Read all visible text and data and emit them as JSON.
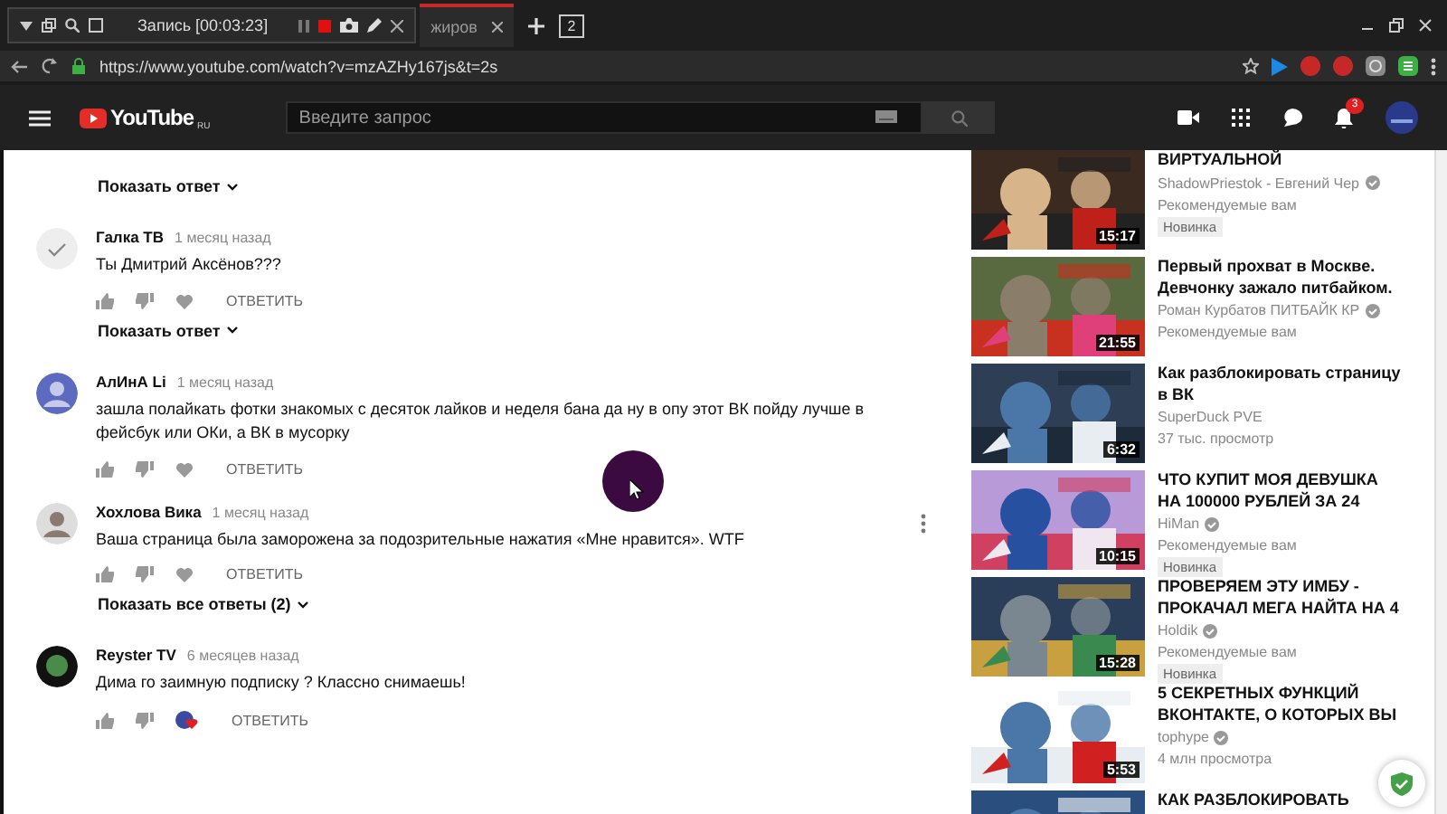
{
  "recorder": {
    "status": "Запись [00:03:23]"
  },
  "browser": {
    "tab_title": "жиров",
    "tab_count": "2",
    "url": "https://www.youtube.com/watch?v=mzAZHy167js&t=2s"
  },
  "youtube": {
    "logo": "YouTube",
    "region": "RU",
    "search": {
      "placeholder": "Введите запрос"
    },
    "notifications": "3"
  },
  "comments": [
    {
      "kind": "show_replies",
      "label": "Показать ответ"
    },
    {
      "kind": "comment",
      "author": "Галка ТВ",
      "time": "1 месяц назад",
      "text": "Ты Дмитрий Аксёнов???",
      "avatar": {
        "kind": "check"
      },
      "creator_heart": false,
      "menu": false,
      "reply": "ОТВЕТИТЬ"
    },
    {
      "kind": "show_replies",
      "label": "Показать ответ"
    },
    {
      "kind": "comment",
      "author": "АлИнА Li",
      "time": "1 месяц назад",
      "text": "зашла полайкать фотки знакомых с десяток лайков и неделя бана да ну в опу этот ВК пойду лучше в фейсбук или ОКи, а ВК в мусорку",
      "avatar": {
        "kind": "person"
      },
      "creator_heart": false,
      "menu": false,
      "reply": "ОТВЕТИТЬ"
    },
    {
      "kind": "comment",
      "author": "Хохлова Вика",
      "time": "1 месяц назад",
      "text": "Ваша страница была заморожена за подозрительные нажатия «Мне нравится». WTF",
      "creator_heart": false,
      "menu": true,
      "reply": "ОТВЕТИТЬ"
    },
    {
      "kind": "show_replies",
      "label": "Показать все ответы (2)"
    },
    {
      "kind": "comment",
      "author": "Reyster TV",
      "time": "6 месяцев назад",
      "text": "Дима го заимную подписку ? Классно снимаешь!",
      "avatar": {
        "kind": "dark"
      },
      "creator_heart": true,
      "menu": false,
      "reply": "ОТВЕТИТЬ"
    }
  ],
  "videos": [
    {
      "title": "ВИРТУАЛЬНОЙ",
      "channel": "ShadowPriestok - Евгений Чер",
      "verified": true,
      "meta": "Рекомендуемые вам",
      "badge": "Новинка",
      "duration": "15:17"
    },
    {
      "title": "Первый прохват в Москве. Девчонку зажало питбайком.",
      "channel": "Роман Курбатов ПИТБАЙК КР",
      "verified": true,
      "meta": "Рекомендуемые вам",
      "duration": "21:55"
    },
    {
      "title": "Как разблокировать страницу в ВК",
      "channel": "SuperDuck PVE",
      "verified": false,
      "meta": "37 тыс. просмотр",
      "duration": "6:32"
    },
    {
      "title": "ЧТО КУПИТ МОЯ ДЕВУШКА НА 100000 РУБЛЕЙ ЗА 24",
      "channel": "HiMan",
      "verified": true,
      "meta": "Рекомендуемые вам",
      "badge": "Новинка",
      "duration": "10:15"
    },
    {
      "title": "ПРОВЕРЯЕМ ЭТУ ИМБУ - ПРОКАЧАЛ МЕГА НАЙТА НА 4",
      "channel": "Holdik",
      "verified": true,
      "meta": "Рекомендуемые вам",
      "badge": "Новинка",
      "duration": "15:28"
    },
    {
      "title": "5 СЕКРЕТНЫХ ФУНКЦИЙ ВКОНТАКТЕ, О КОТОРЫХ ВЫ",
      "channel": "tophype",
      "verified": true,
      "meta": "4 млн просмотра",
      "duration": "5:53"
    },
    {
      "title": "КАК РАЗБЛОКИРОВАТЬ"
    }
  ]
}
